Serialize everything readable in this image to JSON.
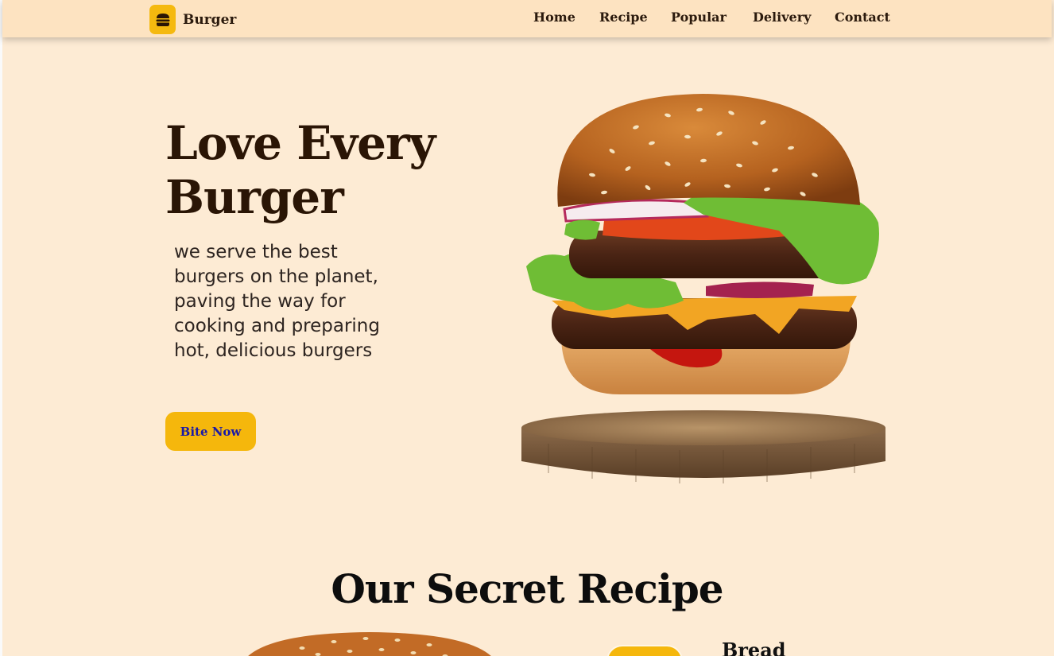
{
  "header": {
    "brand": "Burger",
    "brand_icon": "burger-icon",
    "nav": [
      "Home",
      "Recipe",
      "Popular",
      "Delivery",
      "Contact"
    ]
  },
  "hero": {
    "title_line1": "Love Every",
    "title_line2": "Burger",
    "description": "we serve the best burgers on the planet, paving the way for cooking and preparing hot, delicious burgers",
    "cta_label": "Bite Now"
  },
  "recipe": {
    "title": "Our Secret Recipe",
    "first_item": "Bread"
  },
  "colors": {
    "background": "#fdebd4",
    "header": "#fde3c1",
    "accent": "#f5b70c",
    "text": "#2a1505"
  }
}
